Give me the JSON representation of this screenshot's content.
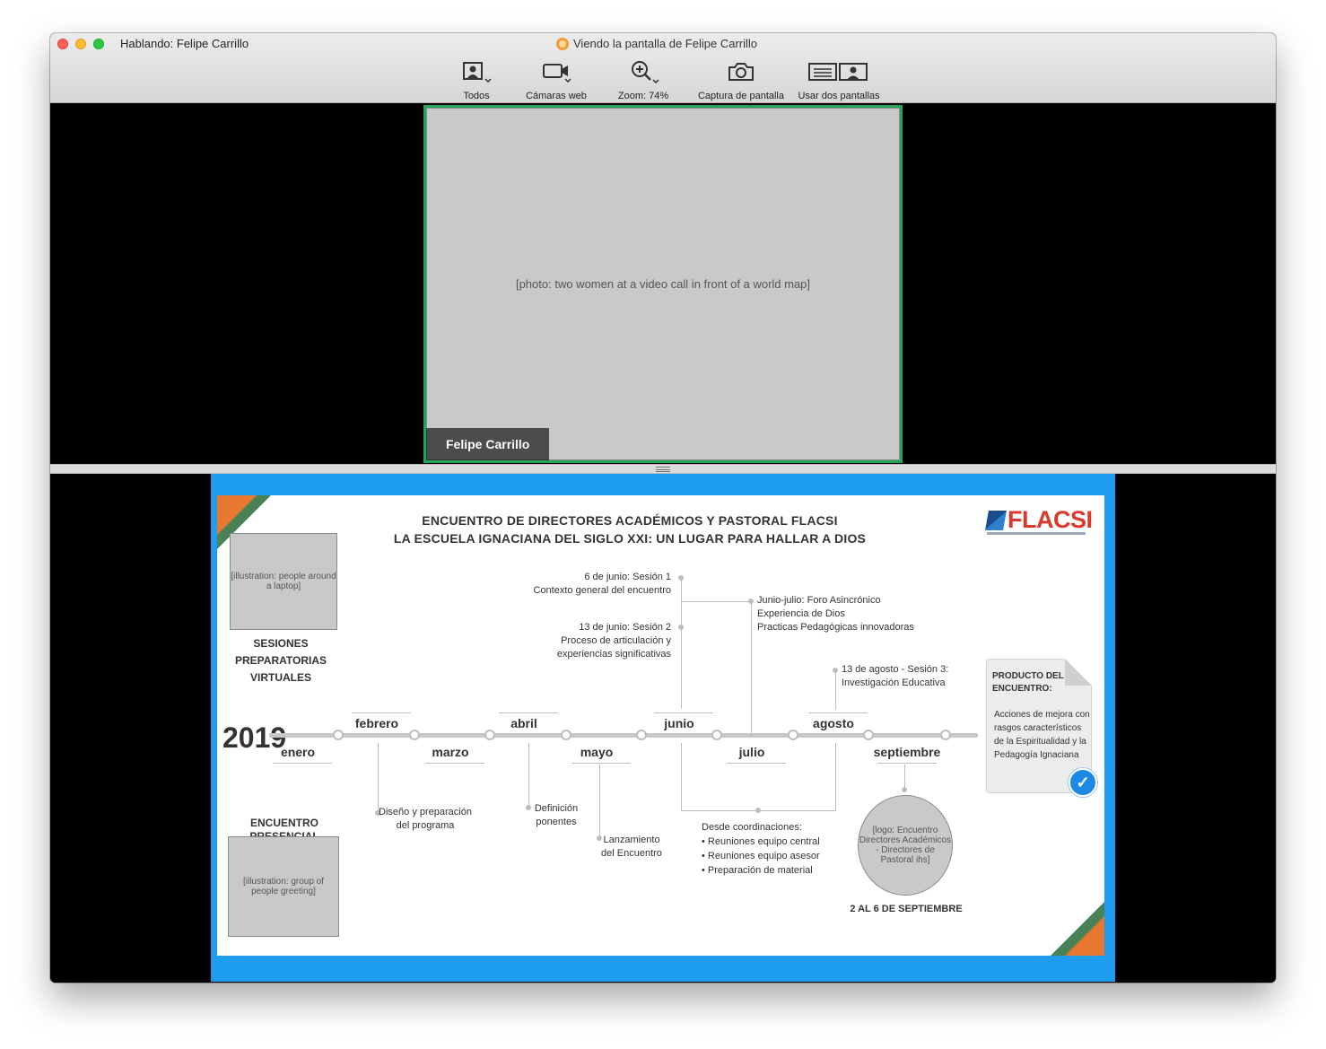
{
  "window": {
    "speaking_label": "Hablando: Felipe Carrillo",
    "viewing_label": "Viendo la pantalla de Felipe Carrillo"
  },
  "toolbar": {
    "items": [
      {
        "label": "Todos",
        "icon": "gallery-view-icon"
      },
      {
        "label": "Cámaras web",
        "icon": "video-camera-icon"
      },
      {
        "label": "Zoom: 74%",
        "icon": "zoom-in-icon"
      },
      {
        "label": "Captura de pantalla",
        "icon": "camera-icon"
      },
      {
        "label": "Usar dos pantallas",
        "icon": "dual-monitor-icon"
      }
    ]
  },
  "video": {
    "participant_name": "Felipe Carrillo",
    "photo_label": "[photo: two women at a video call in front of a world map]"
  },
  "slide": {
    "title_line1": "ENCUENTRO DE DIRECTORES ACADÉMICOS Y PASTORAL FLACSI",
    "title_line2": "LA ESCUELA IGNACIANA DEL SIGLO XXI: UN LUGAR PARA HALLAR A DIOS",
    "logo_text": "FLACSI",
    "virtual_line1": "SESIONES PREPARATORIAS",
    "virtual_line2": "VIRTUALES",
    "presencial": "ENCUENTRO PRESENCIAL",
    "year": "2019",
    "months_top": [
      "febrero",
      "abril",
      "junio",
      "agosto"
    ],
    "months_bottom": [
      "enero",
      "marzo",
      "mayo",
      "julio",
      "septiembre"
    ],
    "session1_title": "6 de junio: Sesión 1",
    "session1_desc": "Contexto general del encuentro",
    "session2_title": "13 de junio: Sesión 2",
    "session2_desc1": "Proceso de articulación y",
    "session2_desc2": "experiencias significativas",
    "foro_title": "Junio-julio: Foro Asincrónico",
    "foro_desc1": "Experiencia de Dios",
    "foro_desc2": "Practicas Pedagógicas innovadoras",
    "session3_title": "13 de agosto - Sesión 3:",
    "session3_desc": "Investigación Educativa",
    "diseno_line1": "Diseño y preparación",
    "diseno_line2": "del programa",
    "definicion_line1": "Definición",
    "definicion_line2": "ponentes",
    "lanzamiento_line1": "Lanzamiento",
    "lanzamiento_line2": "del Encuentro",
    "coord_title": "Desde coordinaciones:",
    "coord_items": [
      "Reuniones equipo central",
      "Reuniones equipo asesor",
      "Preparación de material"
    ],
    "producto_title1": "PRODUCTO DEL",
    "producto_title2": "ENCUENTRO:",
    "producto_desc": "Acciones de mejora con rasgos característicos de la Espiritualidad y la Pedagogía Ignaciana",
    "event_dates": "2 AL 6 DE SEPTIEMBRE",
    "illus_virtual": "[illustration: people around a laptop]",
    "illus_presencial": "[illustration: group of people greeting]",
    "illus_logo": "[logo: Encuentro Directores Académicos - Directores de Pastoral ihs]"
  }
}
